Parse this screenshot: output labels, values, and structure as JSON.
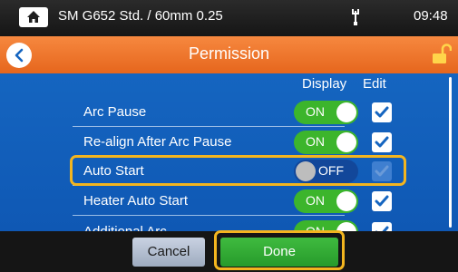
{
  "statusbar": {
    "title": "SM G652 Std. / 60mm 0.25",
    "time": "09:48",
    "home_icon": "home-icon",
    "usb_icon": "usb-icon"
  },
  "header": {
    "title": "Permission",
    "back_icon": "chevron-left-icon",
    "lock_icon": "unlock-icon"
  },
  "columns": {
    "display": "Display",
    "edit": "Edit"
  },
  "rows": [
    {
      "label": "Arc Pause",
      "toggle": "ON",
      "state": "on",
      "edit_checked": true
    },
    {
      "label": "Re-align After Arc Pause",
      "toggle": "ON",
      "state": "on",
      "edit_checked": true
    },
    {
      "label": "Auto Start",
      "toggle": "OFF",
      "state": "off",
      "edit_checked": true,
      "edit_disabled": true,
      "highlighted": true
    },
    {
      "label": "Heater Auto Start",
      "toggle": "ON",
      "state": "on",
      "edit_checked": true
    },
    {
      "label": "Additional Arc",
      "toggle": "ON",
      "state": "on",
      "edit_checked": true
    }
  ],
  "footer": {
    "cancel_label": "Cancel",
    "done_label": "Done"
  },
  "colors": {
    "header_accent": "#e6661d",
    "content_bg": "#1565c0",
    "toggle_on": "#3cb52c",
    "highlight": "#f3b51f",
    "done_button": "#279b2b"
  }
}
